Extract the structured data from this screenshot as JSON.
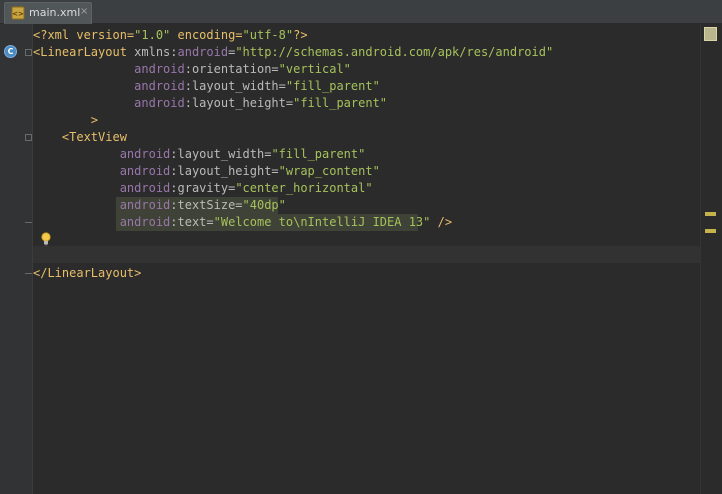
{
  "tab": {
    "file_name": "main.xml",
    "close": "×"
  },
  "gutter": {
    "class_marker": "C"
  },
  "editor": {
    "lines": [
      [
        {
          "t": "<?xml version=",
          "c": "tag"
        },
        {
          "t": "\"1.0\"",
          "c": "val"
        },
        {
          "t": " encoding=",
          "c": "tag"
        },
        {
          "t": "\"utf-8\"",
          "c": "val"
        },
        {
          "t": "?>",
          "c": "tag"
        }
      ],
      [
        {
          "t": "<LinearLayout",
          "c": "tag"
        },
        {
          "t": " xmlns:",
          "c": "attr"
        },
        {
          "t": "android",
          "c": "ns"
        },
        {
          "t": "=",
          "c": "attr"
        },
        {
          "t": "\"http://schemas.android.com/apk/res/android\"",
          "c": "val"
        }
      ],
      [
        {
          "t": "              ",
          "c": "plain"
        },
        {
          "t": "android",
          "c": "ns"
        },
        {
          "t": ":orientation=",
          "c": "attr"
        },
        {
          "t": "\"vertical\"",
          "c": "val"
        }
      ],
      [
        {
          "t": "              ",
          "c": "plain"
        },
        {
          "t": "android",
          "c": "ns"
        },
        {
          "t": ":layout_width=",
          "c": "attr"
        },
        {
          "t": "\"fill_parent\"",
          "c": "val"
        }
      ],
      [
        {
          "t": "              ",
          "c": "plain"
        },
        {
          "t": "android",
          "c": "ns"
        },
        {
          "t": ":layout_height=",
          "c": "attr"
        },
        {
          "t": "\"fill_parent\"",
          "c": "val"
        }
      ],
      [
        {
          "t": "        >",
          "c": "tag"
        }
      ],
      [
        {
          "t": "    <TextView",
          "c": "tag"
        }
      ],
      [
        {
          "t": "            ",
          "c": "plain"
        },
        {
          "t": "android",
          "c": "ns"
        },
        {
          "t": ":layout_width=",
          "c": "attr"
        },
        {
          "t": "\"fill_parent\"",
          "c": "val"
        }
      ],
      [
        {
          "t": "            ",
          "c": "plain"
        },
        {
          "t": "android",
          "c": "ns"
        },
        {
          "t": ":layout_height=",
          "c": "attr"
        },
        {
          "t": "\"wrap_content\"",
          "c": "val"
        }
      ],
      [
        {
          "t": "            ",
          "c": "plain"
        },
        {
          "t": "android",
          "c": "ns"
        },
        {
          "t": ":gravity=",
          "c": "attr"
        },
        {
          "t": "\"center_horizontal\"",
          "c": "val"
        }
      ],
      [
        {
          "t": "            ",
          "c": "plain"
        },
        {
          "t": "android",
          "c": "ns"
        },
        {
          "t": ":textSize=",
          "c": "attr"
        },
        {
          "t": "\"40dp\"",
          "c": "val"
        }
      ],
      [
        {
          "t": "            ",
          "c": "plain"
        },
        {
          "t": "android",
          "c": "ns"
        },
        {
          "t": ":text=",
          "c": "attr"
        },
        {
          "t": "\"Welcome to\\nIntelliJ IDEA 13\"",
          "c": "val"
        },
        {
          "t": " />",
          "c": "tag"
        }
      ],
      [
        {
          "t": "",
          "c": "plain"
        }
      ],
      [
        {
          "t": "",
          "c": "plain"
        }
      ],
      [
        {
          "t": "</LinearLayout>",
          "c": "tag"
        }
      ]
    ]
  },
  "colors": {
    "tag": "#e8bf6a",
    "namespace": "#9876aa",
    "attribute": "#bababa",
    "value": "#a5c25c",
    "background": "#2b2b2b",
    "warning_marker": "#c4b24c"
  },
  "icons": {
    "tab_icon": "xml-file-icon",
    "class_marker": "class-marker-icon",
    "intention": "lightbulb-icon",
    "status": "inspection-status-icon"
  }
}
